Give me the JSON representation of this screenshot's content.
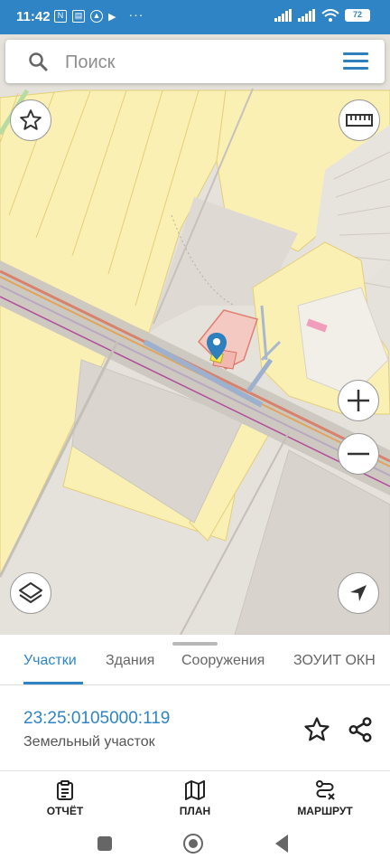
{
  "status_bar": {
    "time": "11:42",
    "battery": "72",
    "icons": [
      "nfc-icon",
      "sim-card-icon",
      "vpn-icon",
      "play-icon",
      "more-dots-icon",
      "signal-icon",
      "wifi-icon",
      "battery-icon"
    ]
  },
  "search": {
    "placeholder": "Поиск"
  },
  "panel": {
    "tabs": [
      {
        "label": "Участки",
        "active": true
      },
      {
        "label": "Здания",
        "active": false
      },
      {
        "label": "Сооружения",
        "active": false
      },
      {
        "label": "ЗОУИТ ОКН",
        "active": false
      }
    ],
    "parcel": {
      "number": "23:25:0105000:119",
      "type": "Земельный участок"
    }
  },
  "bottom_nav": {
    "report": "ОТЧЁТ",
    "plan": "ПЛАН",
    "route": "МАРШРУТ"
  },
  "colors": {
    "accent": "#2f84c6",
    "parcel_fill": "#faf0b4",
    "selected_parcel": "#f4c9c2"
  }
}
